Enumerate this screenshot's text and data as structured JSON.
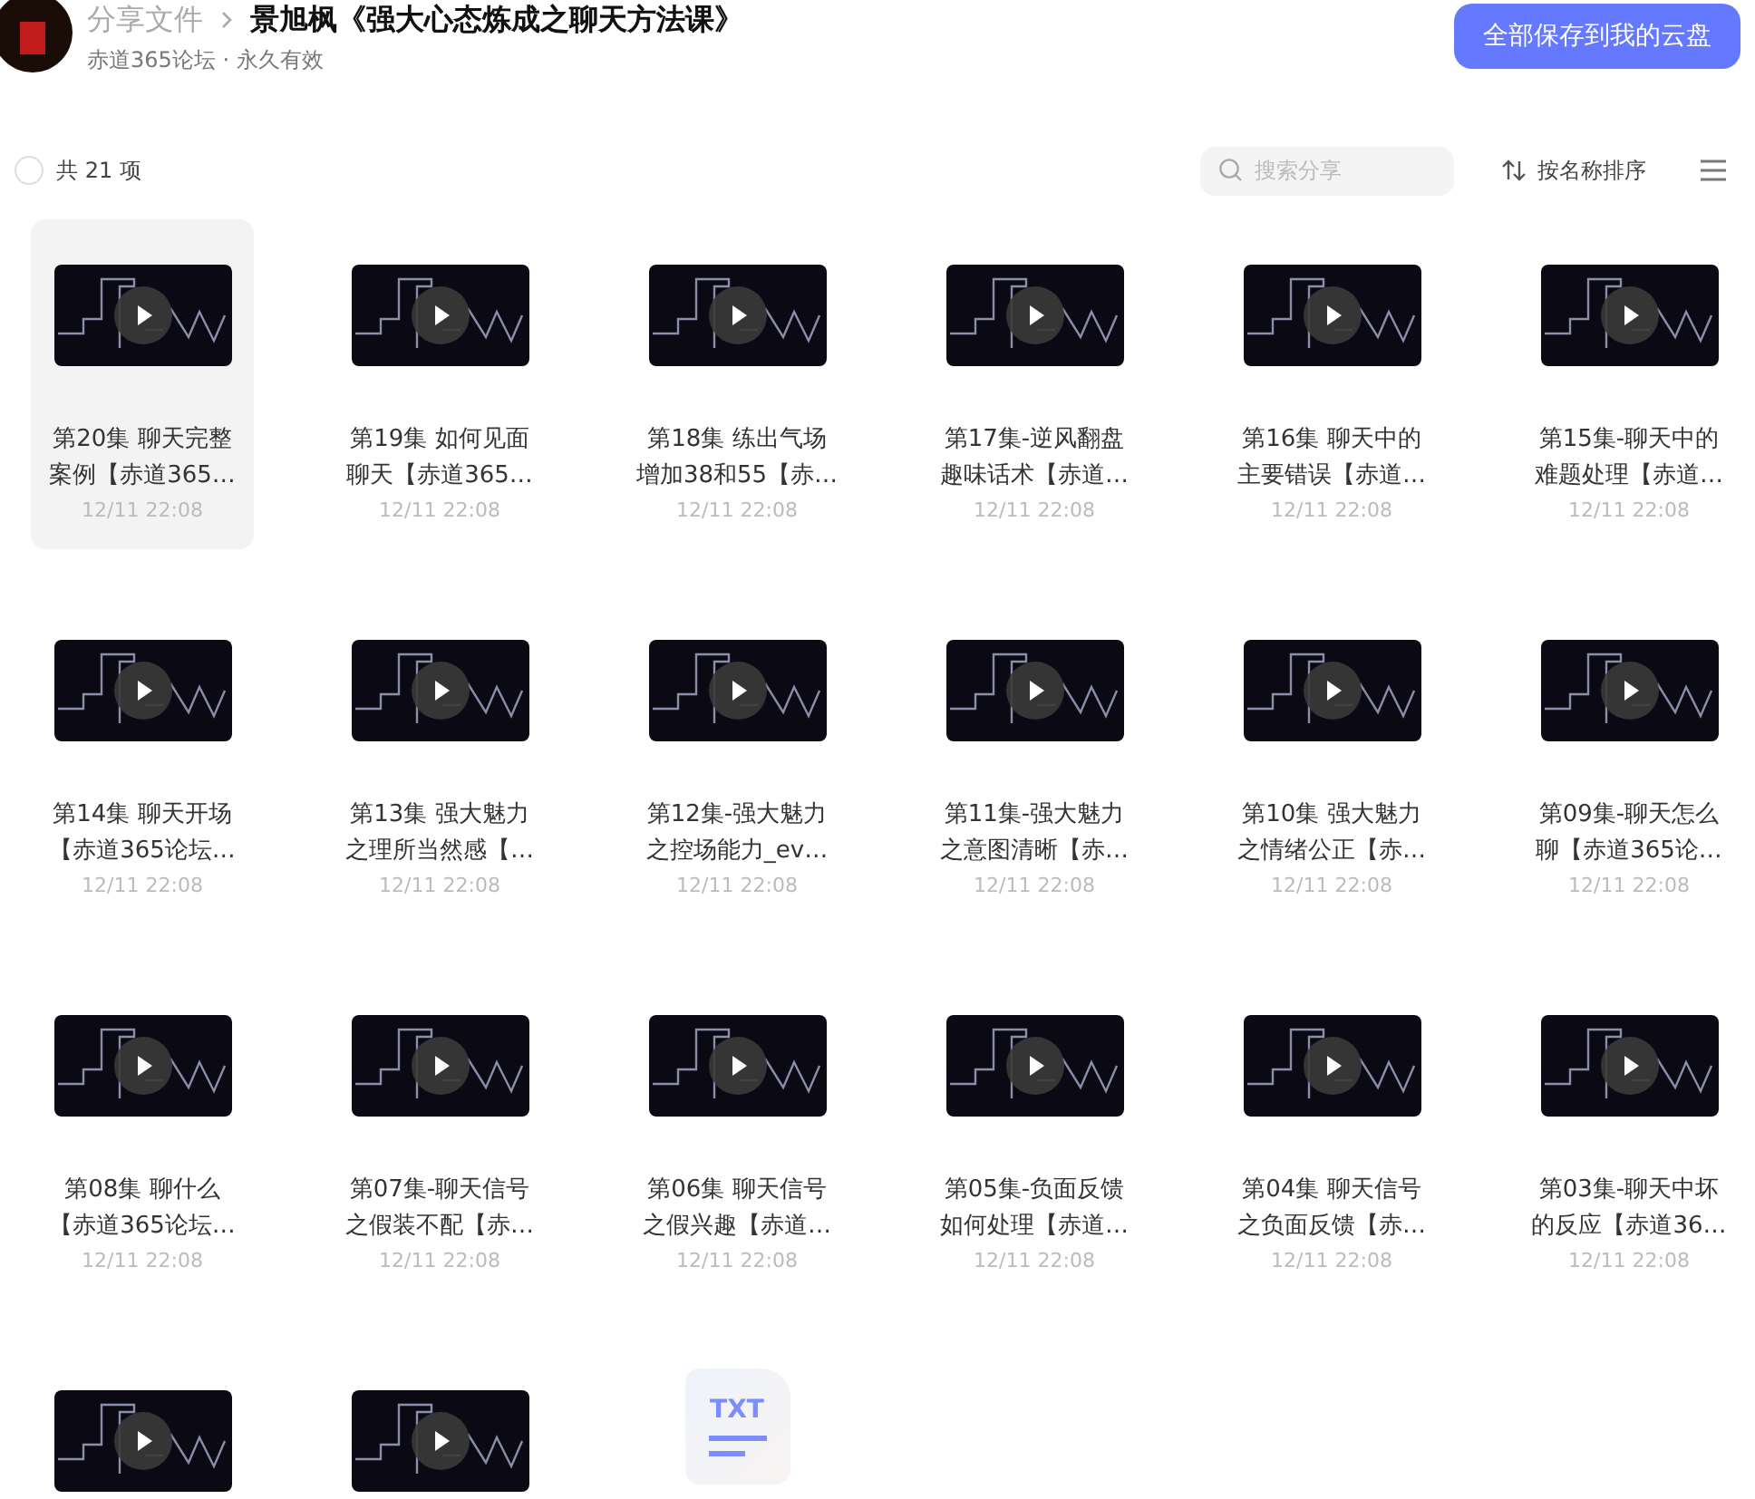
{
  "header": {
    "breadcrumb_root": "分享文件",
    "title": "景旭枫《强大心态炼成之聊天方法课》",
    "subtitle": "赤道365论坛 · 永久有效",
    "save_button": "全部保存到我的云盘"
  },
  "toolbar": {
    "select_all": {
      "checked": false,
      "label": "共 21 项"
    },
    "search": {
      "placeholder": "搜索分享"
    },
    "sort": "按名称排序"
  },
  "files": [
    {
      "kind": "video",
      "selected": true,
      "title_lines": [
        "第20集 聊天完整",
        "案例【赤道365…"
      ],
      "date": "12/11 22:08"
    },
    {
      "kind": "video",
      "selected": false,
      "title_lines": [
        "第19集 如何见面",
        "聊天【赤道365…"
      ],
      "date": "12/11 22:08"
    },
    {
      "kind": "video",
      "selected": false,
      "title_lines": [
        "第18集 练出气场",
        "增加38和55【赤…"
      ],
      "date": "12/11 22:08"
    },
    {
      "kind": "video",
      "selected": false,
      "title_lines": [
        "第17集-逆风翻盘",
        "趣味话术【赤道…"
      ],
      "date": "12/11 22:08"
    },
    {
      "kind": "video",
      "selected": false,
      "title_lines": [
        "第16集 聊天中的",
        "主要错误【赤道…"
      ],
      "date": "12/11 22:08"
    },
    {
      "kind": "video",
      "selected": false,
      "title_lines": [
        "第15集-聊天中的",
        "难题处理【赤道…"
      ],
      "date": "12/11 22:08"
    },
    {
      "kind": "video",
      "selected": false,
      "title_lines": [
        "第14集 聊天开场",
        "【赤道365论坛…"
      ],
      "date": "12/11 22:08"
    },
    {
      "kind": "video",
      "selected": false,
      "title_lines": [
        "第13集 强大魅力",
        "之理所当然感【…"
      ],
      "date": "12/11 22:08"
    },
    {
      "kind": "video",
      "selected": false,
      "title_lines": [
        "第12集-强大魅力",
        "之控场能力_ev…"
      ],
      "date": "12/11 22:08"
    },
    {
      "kind": "video",
      "selected": false,
      "title_lines": [
        "第11集-强大魅力",
        "之意图清晰【赤…"
      ],
      "date": "12/11 22:08"
    },
    {
      "kind": "video",
      "selected": false,
      "title_lines": [
        "第10集 强大魅力",
        "之情绪公正【赤…"
      ],
      "date": "12/11 22:08"
    },
    {
      "kind": "video",
      "selected": false,
      "title_lines": [
        "第09集-聊天怎么",
        "聊【赤道365论…"
      ],
      "date": "12/11 22:08"
    },
    {
      "kind": "video",
      "selected": false,
      "title_lines": [
        "第08集 聊什么",
        "【赤道365论坛…"
      ],
      "date": "12/11 22:08"
    },
    {
      "kind": "video",
      "selected": false,
      "title_lines": [
        "第07集-聊天信号",
        "之假装不配【赤…"
      ],
      "date": "12/11 22:08"
    },
    {
      "kind": "video",
      "selected": false,
      "title_lines": [
        "第06集 聊天信号",
        "之假兴趣【赤道…"
      ],
      "date": "12/11 22:08"
    },
    {
      "kind": "video",
      "selected": false,
      "title_lines": [
        "第05集-负面反馈",
        "如何处理【赤道…"
      ],
      "date": "12/11 22:08"
    },
    {
      "kind": "video",
      "selected": false,
      "title_lines": [
        "第04集 聊天信号",
        "之负面反馈【赤…"
      ],
      "date": "12/11 22:08"
    },
    {
      "kind": "video",
      "selected": false,
      "title_lines": [
        "第03集-聊天中坏",
        "的反应【赤道36…"
      ],
      "date": "12/11 22:08"
    },
    {
      "kind": "video",
      "selected": false
    },
    {
      "kind": "video",
      "selected": false
    },
    {
      "kind": "txt",
      "selected": false,
      "type_label": "TXT"
    }
  ]
}
